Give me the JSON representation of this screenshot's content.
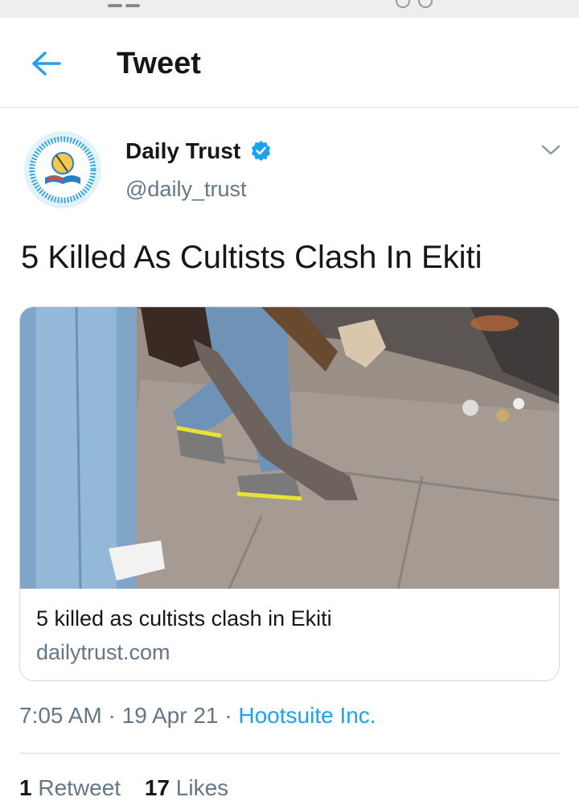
{
  "header": {
    "title": "Tweet",
    "back_icon": "arrow-left-icon"
  },
  "tweet": {
    "author_name": "Daily Trust",
    "author_handle": "@daily_trust",
    "verified": true,
    "text": "5 Killed As Cultists Clash In Ekiti",
    "card": {
      "title": "5 killed as cultists clash in Ekiti",
      "domain": "dailytrust.com"
    },
    "time": "7:05 AM",
    "separator": "·",
    "date": "19 Apr 21",
    "source": "Hootsuite Inc.",
    "retweet_count": "1",
    "retweet_label": "Retweet",
    "like_count": "17",
    "like_label": "Likes"
  },
  "colors": {
    "accent": "#1da1f2",
    "text": "#14171a",
    "secondary": "#657786"
  }
}
